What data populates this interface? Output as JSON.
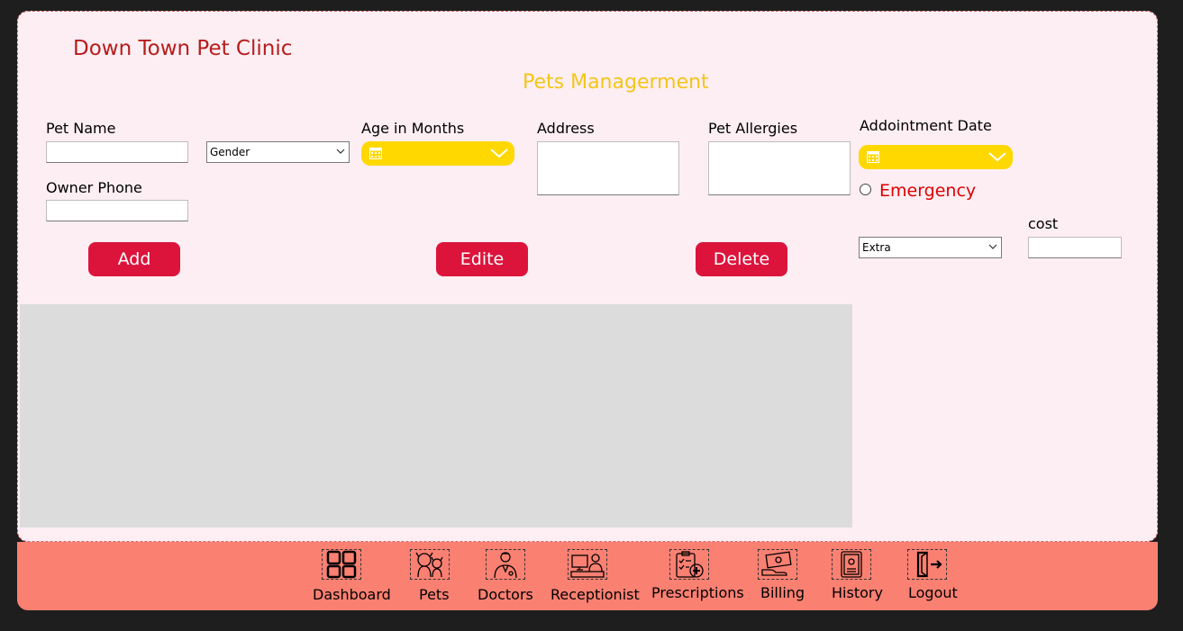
{
  "header": {
    "clinic_name": "Down Town Pet Clinic",
    "section_title": "Pets Managerment"
  },
  "form": {
    "pet_name_label": "Pet Name",
    "pet_name_value": "",
    "gender_select": "Gender",
    "age_label": "Age in Months",
    "address_label": "Address",
    "allergies_label": "Pet Allergies",
    "appointment_label": "Addointment Date",
    "owner_phone_label": "Owner Phone",
    "emergency_label": "Emergency",
    "extra_select": "Extra",
    "cost_label": "cost"
  },
  "buttons": {
    "add": "Add",
    "edit": "Edite",
    "delete": "Delete"
  },
  "nav": {
    "items": [
      {
        "label": "Dashboard",
        "icon": "dashboard-icon"
      },
      {
        "label": "Pets",
        "icon": "pets-icon"
      },
      {
        "label": "Doctors",
        "icon": "doctor-icon"
      },
      {
        "label": "Receptionist",
        "icon": "receptionist-icon"
      },
      {
        "label": "Prescriptions",
        "icon": "prescription-icon"
      },
      {
        "label": "Billing",
        "icon": "billing-icon"
      },
      {
        "label": "History",
        "icon": "history-icon"
      },
      {
        "label": "Logout",
        "icon": "logout-icon"
      }
    ]
  },
  "colors": {
    "title_red": "#b71c1c",
    "subtitle_yellow": "#f5c518",
    "button_red": "#dc143c",
    "date_yellow": "#ffd800",
    "nav_salmon": "#fa8072",
    "panel_pink": "#fdeef3"
  }
}
